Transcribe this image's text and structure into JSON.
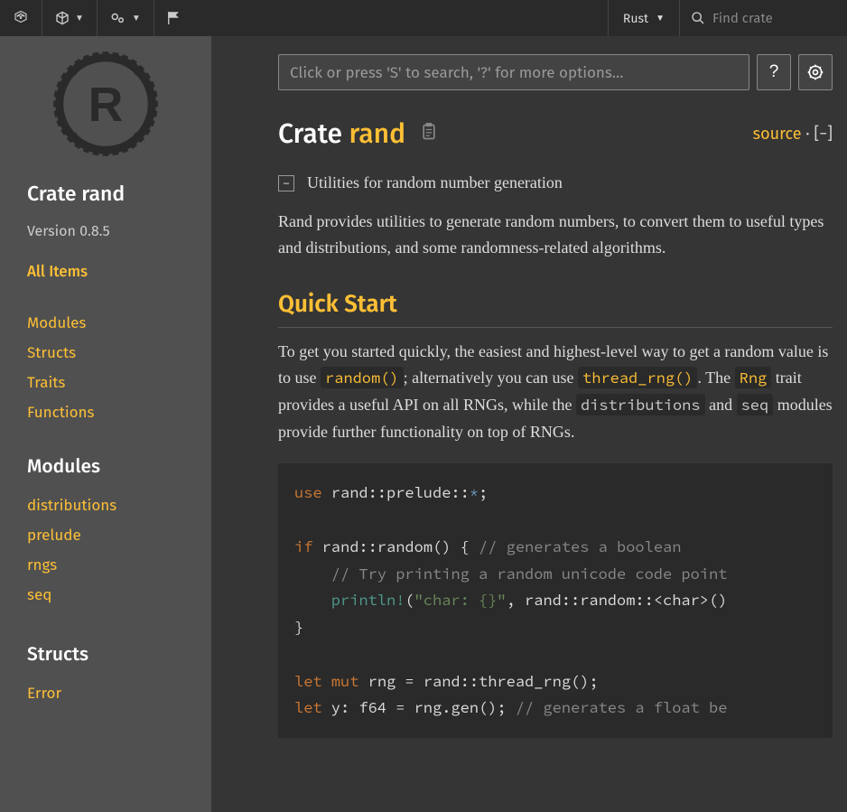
{
  "topbar": {
    "language": "Rust",
    "search_placeholder": "Find crate"
  },
  "sidebar": {
    "title": "Crate rand",
    "version": "Version 0.8.5",
    "all_items": "All Items",
    "sections": [
      "Modules",
      "Structs",
      "Traits",
      "Functions"
    ],
    "modules_header": "Modules",
    "modules": [
      "distributions",
      "prelude",
      "rngs",
      "seq"
    ],
    "structs_header": "Structs",
    "structs": [
      "Error"
    ]
  },
  "main": {
    "search_placeholder": "Click or press 'S' to search, '?' for more options…",
    "help_label": "?",
    "crate_label": "Crate ",
    "crate_name": "rand",
    "source_label": "source",
    "separator": " · ",
    "collapse": "[−]",
    "toggle": "−",
    "summary": "Utilities for random number generation",
    "description": "Rand provides utilities to generate random numbers, to convert them to useful types and distributions, and some randomness-related algorithms.",
    "quick_start": "Quick Start",
    "body1_a": "To get you started quickly, the easiest and highest-level way to get a random value is to use ",
    "body1_code1": "random()",
    "body1_b": "; alternatively you can use ",
    "body1_code2": "thread_rng()",
    "body1_c": ". The ",
    "body1_code3": "Rng",
    "body1_d": " trait provides a useful API on all RNGs, while the ",
    "body1_code4": "distributions",
    "body1_e": " and ",
    "body1_code5": "seq",
    "body1_f": " modules provide further functionality on top of RNGs.",
    "code": {
      "l1_kw": "use",
      "l1_rest": " rand::prelude::",
      "l1_star": "*",
      "l1_end": ";",
      "l2_kw": "if",
      "l2_rest": " rand::random() { ",
      "l2_cm": "// generates a boolean",
      "l3_cm": "    // Try printing a random unicode code point",
      "l4_macro": "    println!",
      "l4_a": "(",
      "l4_str": "\"char: {}\"",
      "l4_b": ", rand::random::<char>()",
      "l5": "}",
      "l6_kw": "let",
      "l6_kw2": " mut",
      "l6_rest": " rng = rand::thread_rng();",
      "l7_kw": "let",
      "l7_rest": " y: f64 = rng.gen(); ",
      "l7_cm": "// generates a float be"
    }
  }
}
